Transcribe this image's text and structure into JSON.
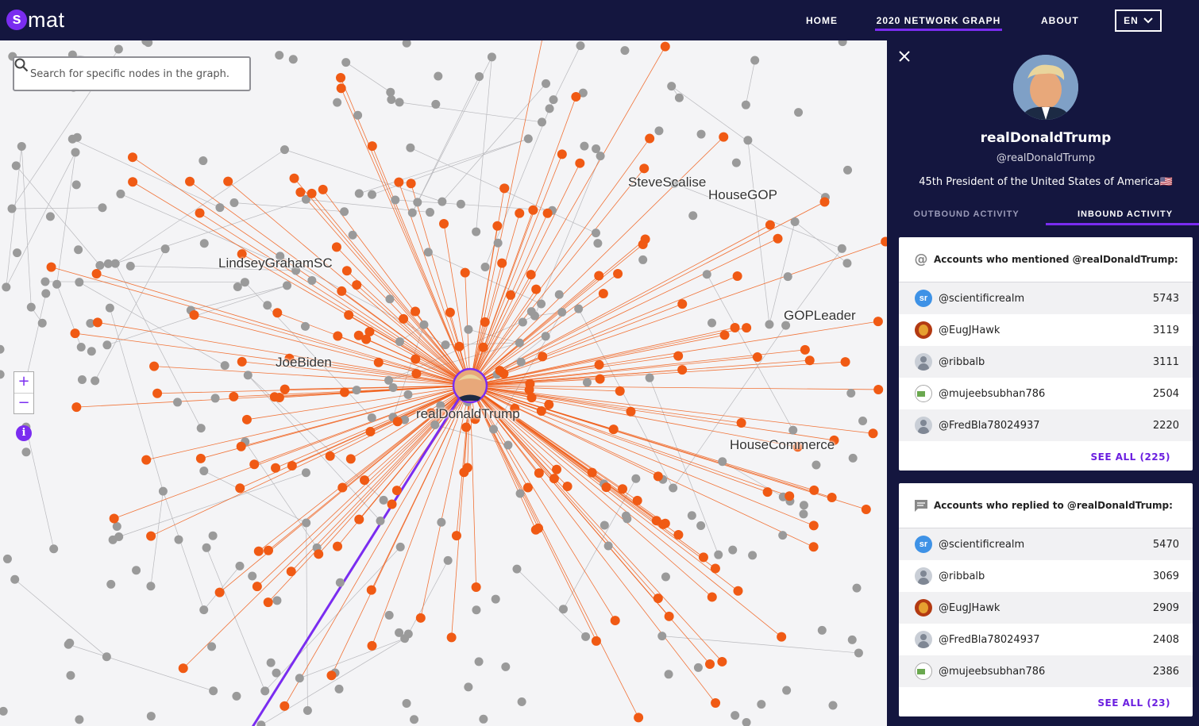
{
  "brand": {
    "logo_letter": "s",
    "logo_text": "mat"
  },
  "nav": {
    "home": "HOME",
    "graph": "2020 NETWORK GRAPH",
    "about": "ABOUT",
    "language": "EN"
  },
  "search": {
    "placeholder": "Search for specific nodes in the graph..."
  },
  "zoom": {
    "in": "+",
    "out": "−"
  },
  "info_label": "i",
  "graph_labels": {
    "trump": "realDonaldTrump",
    "lindsey": "LindseyGrahamSC",
    "biden": "JoeBiden",
    "scalise": "SteveScalise",
    "housegop": "HouseGOP",
    "gopleader": "GOPLeader",
    "housecommerce": "HouseCommerce"
  },
  "colors": {
    "highlight": "#f05a14",
    "node": "#9a9a9a",
    "accent": "#7a2cf0",
    "navy": "#14163f"
  },
  "profile": {
    "name": "realDonaldTrump",
    "handle": "@realDonaldTrump",
    "bio": "45th President of the United States of America🇺🇸"
  },
  "tabs": {
    "outbound": "OUTBOUND ACTIVITY",
    "inbound": "INBOUND ACTIVITY"
  },
  "mentioned": {
    "title": "Accounts who mentioned @realDonaldTrump:",
    "rows": [
      {
        "handle": "@scientificrealm",
        "count": "5743",
        "avatar": "sr"
      },
      {
        "handle": "@EugJHawk",
        "count": "3119",
        "avatar": "hawk"
      },
      {
        "handle": "@ribbalb",
        "count": "3111",
        "avatar": "user"
      },
      {
        "handle": "@mujeebsubhan786",
        "count": "2504",
        "avatar": "broken"
      },
      {
        "handle": "@FredBla78024937",
        "count": "2220",
        "avatar": "user"
      }
    ],
    "see_all": "SEE ALL (225)"
  },
  "replied": {
    "title": "Accounts who replied to @realDonaldTrump:",
    "rows": [
      {
        "handle": "@scientificrealm",
        "count": "5470",
        "avatar": "sr"
      },
      {
        "handle": "@ribbalb",
        "count": "3069",
        "avatar": "user"
      },
      {
        "handle": "@EugJHawk",
        "count": "2909",
        "avatar": "hawk"
      },
      {
        "handle": "@FredBla78024937",
        "count": "2408",
        "avatar": "user"
      },
      {
        "handle": "@mujeebsubhan786",
        "count": "2386",
        "avatar": "broken"
      }
    ],
    "see_all": "SEE ALL (23)"
  }
}
